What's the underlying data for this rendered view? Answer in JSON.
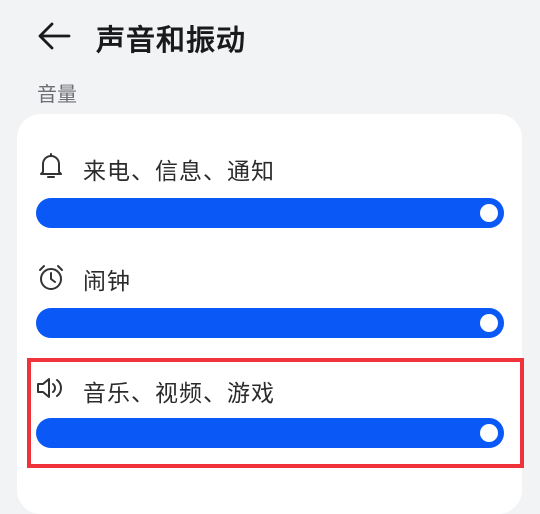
{
  "header": {
    "title": "声音和振动"
  },
  "section": {
    "label": "音量"
  },
  "volume_rows": [
    {
      "label": "来电、信息、通知",
      "icon": "bell-icon",
      "level": 1.0
    },
    {
      "label": "闹钟",
      "icon": "alarm-clock-icon",
      "level": 1.0
    },
    {
      "label": "音乐、视频、游戏",
      "icon": "speaker-icon",
      "level": 1.0
    }
  ],
  "colors": {
    "accent": "#0a59f7",
    "highlight": "#f0323a",
    "background": "#f1f3f5",
    "card": "#ffffff"
  }
}
